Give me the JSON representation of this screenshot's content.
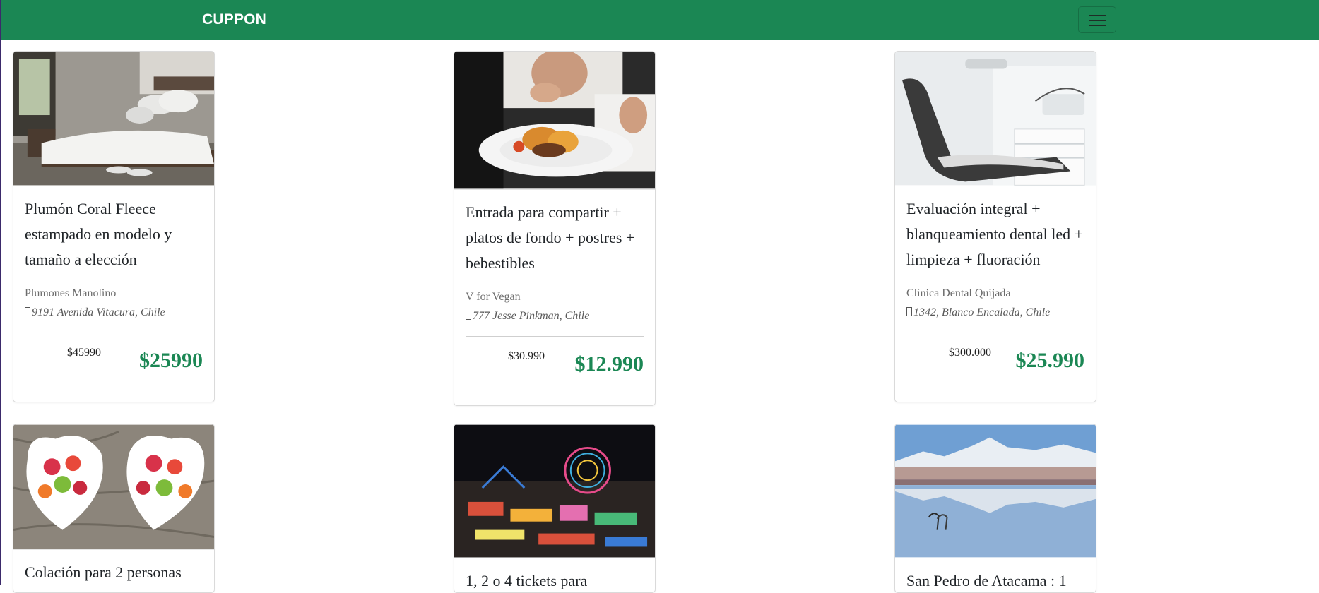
{
  "navbar": {
    "brand": "CUPPON",
    "toggler_icon": "hamburger-icon",
    "brand_color": "#1b8754"
  },
  "cards": [
    {
      "image": "bedroom-photo",
      "title": "Plumón Coral Fleece estampado en modelo y tamaño a elección",
      "company": "Plumones Manolino",
      "address": "9191 Avenida Vitacura, Chile",
      "old_price": "$45990",
      "new_price": "$25990"
    },
    {
      "image": "chef-plating-photo",
      "title": "Entrada para compartir + platos de fondo + postres + bebestibles",
      "company": "V for Vegan",
      "address": "777 Jesse Pinkman, Chile",
      "old_price": "$30.990",
      "new_price": "$12.990"
    },
    {
      "image": "dental-chair-photo",
      "title": "Evaluación integral + blanqueamiento dental led + limpieza + fluoración",
      "company": "Clínica Dental Quijada",
      "address": "1342, Blanco Encalada, Chile",
      "old_price": "$300.000",
      "new_price": "$25.990"
    },
    {
      "image": "fruit-bowls-photo",
      "title": "Colación para 2 personas"
    },
    {
      "image": "fair-at-night-photo",
      "title": "1, 2 o 4 tickets para"
    },
    {
      "image": "atacama-lagoon-photo",
      "title": "San Pedro de Atacama : 1"
    }
  ]
}
